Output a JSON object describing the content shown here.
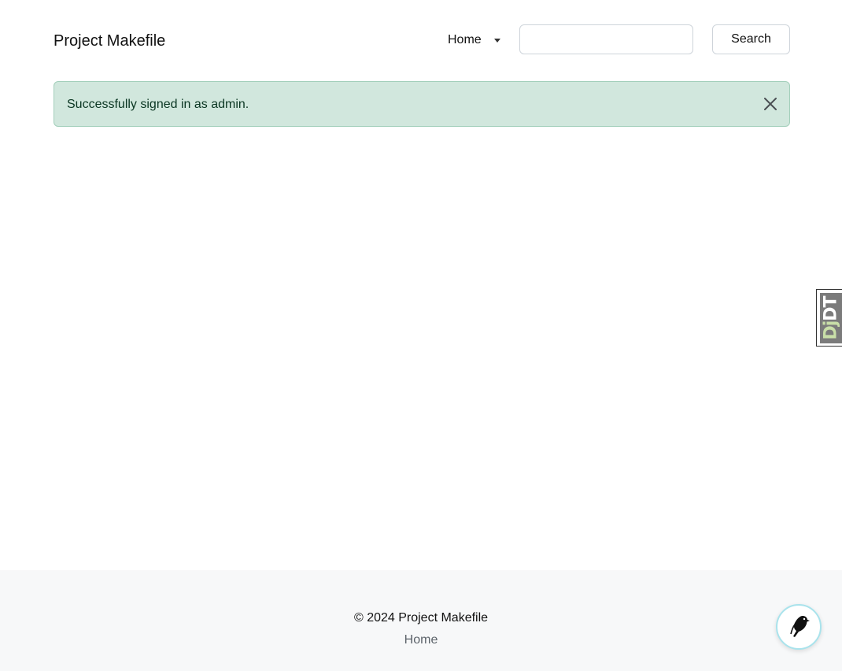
{
  "navbar": {
    "brand": "Project Makefile",
    "home_dropdown_label": "Home",
    "search_placeholder": "",
    "search_value": "",
    "search_button": "Search"
  },
  "alert": {
    "message": "Successfully signed in as admin.",
    "color": "#d1e7dd",
    "text_color": "#0a3622"
  },
  "debug_toolbar": {
    "label_prefix": "Dj",
    "label_suffix": "DT"
  },
  "footer": {
    "copyright": "© 2024 Project Makefile",
    "home_link": "Home"
  },
  "icons": {
    "close": "close-icon",
    "caret": "chevron-down-icon",
    "fab": "bird-icon"
  }
}
